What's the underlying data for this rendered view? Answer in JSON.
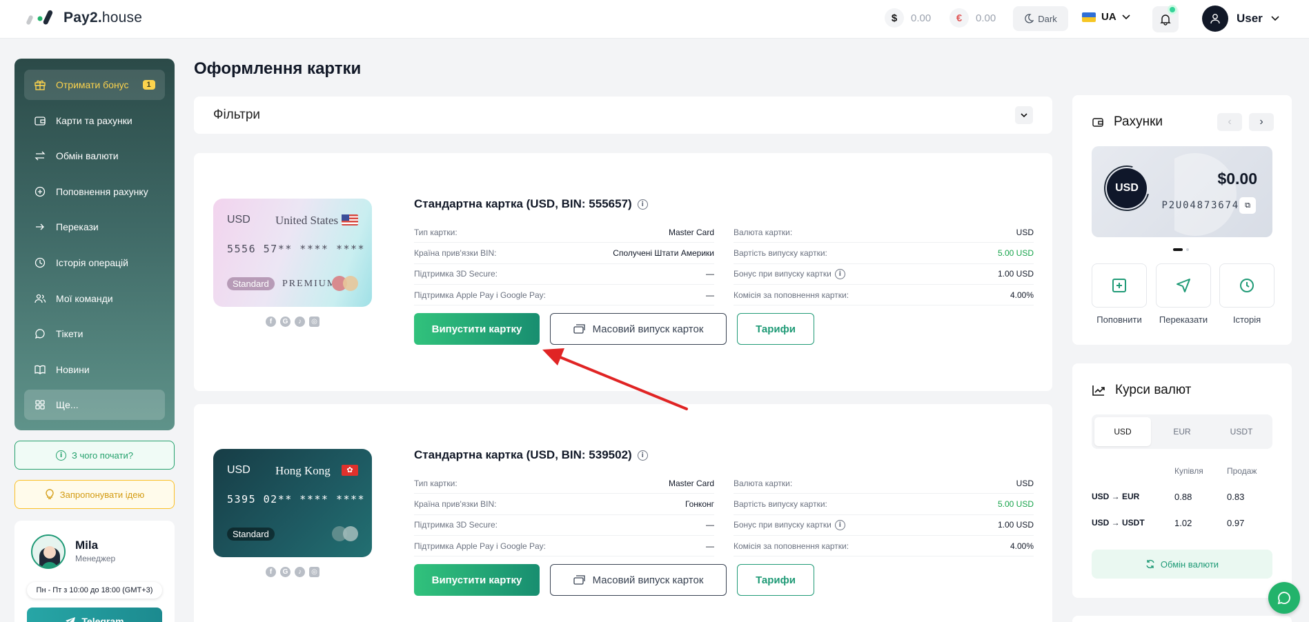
{
  "header": {
    "logo_bold": "Pay2.",
    "logo_rest": "house",
    "usd_balance": "0.00",
    "eur_balance": "0.00",
    "usd_symbol": "$",
    "eur_symbol": "€",
    "dark_label": "Dark",
    "lang": "UA",
    "user_name": "User"
  },
  "sidebar": {
    "items": [
      {
        "label": "Отримати бонус",
        "badge": "1",
        "icon": "gift-icon"
      },
      {
        "label": "Карти та рахунки",
        "icon": "wallet-icon"
      },
      {
        "label": "Обмін валюти",
        "icon": "swap-icon"
      },
      {
        "label": "Поповнення рахунку",
        "icon": "plus-circle-icon"
      },
      {
        "label": "Перекази",
        "icon": "arrow-right-icon"
      },
      {
        "label": "Історія операцій",
        "icon": "clock-icon"
      },
      {
        "label": "Мої команди",
        "icon": "users-icon"
      },
      {
        "label": "Тікети",
        "icon": "chat-icon"
      },
      {
        "label": "Новини",
        "icon": "book-icon"
      },
      {
        "label": "Ще...",
        "icon": "grid-icon"
      }
    ],
    "start_label": "З чого почати?",
    "idea_label": "Запропонувати ідею",
    "manager": {
      "name": "Mila",
      "role": "Менеджер",
      "hours": "Пн - Пт з 10:00 до 18:00 (GMT+3)",
      "telegram": "Telegram"
    }
  },
  "main": {
    "title": "Оформлення картки",
    "filters_label": "Фільтри",
    "cards": [
      {
        "currency": "USD",
        "country": "United States",
        "number": "5556 57** **** ****",
        "tier": "Standard",
        "premium": "PREMIUM",
        "title": "Стандартна картка (USD, BIN: 555657)",
        "left": [
          {
            "label": "Тип картки:",
            "value": "Master Card"
          },
          {
            "label": "Країна прив'язки BIN:",
            "value": "Сполучені Штати Америки"
          },
          {
            "label": "Підтримка 3D Secure:",
            "value": "—"
          },
          {
            "label": "Підтримка Apple Pay і Google Pay:",
            "value": "—"
          }
        ],
        "right": [
          {
            "label": "Валюта картки:",
            "value": "USD"
          },
          {
            "label": "Вартість випуску картки:",
            "value": "5.00 USD"
          },
          {
            "label": "Бонус при випуску картки",
            "value": "1.00 USD"
          },
          {
            "label": "Комісія за поповнення картки:",
            "value": "4.00%"
          }
        ]
      },
      {
        "currency": "USD",
        "country": "Hong Kong",
        "number": "5395 02** **** ****",
        "tier": "Standard",
        "title": "Стандартна картка (USD, BIN: 539502)",
        "left": [
          {
            "label": "Тип картки:",
            "value": "Master Card"
          },
          {
            "label": "Країна прив'язки BIN:",
            "value": "Гонконг"
          },
          {
            "label": "Підтримка 3D Secure:",
            "value": "—"
          },
          {
            "label": "Підтримка Apple Pay і Google Pay:",
            "value": "—"
          }
        ],
        "right": [
          {
            "label": "Валюта картки:",
            "value": "USD"
          },
          {
            "label": "Вартість випуску картки:",
            "value": "5.00 USD"
          },
          {
            "label": "Бонус при випуску картки",
            "value": "1.00 USD"
          },
          {
            "label": "Комісія за поповнення картки:",
            "value": "4.00%"
          }
        ]
      }
    ],
    "issue_label": "Випустити картку",
    "mass_label": "Масовий випуск карток",
    "tariff_label": "Тарифи"
  },
  "accounts": {
    "title": "Рахунки",
    "currency": "USD",
    "amount": "$0.00",
    "account_id": "P2U04873674",
    "actions": [
      "Поповнити",
      "Переказати",
      "Історія"
    ]
  },
  "rates": {
    "title": "Курси валют",
    "tabs": [
      "USD",
      "EUR",
      "USDT"
    ],
    "buy_header": "Купівля",
    "sell_header": "Продаж",
    "rows": [
      {
        "pair": "USD → EUR",
        "buy": "0.88",
        "sell": "0.83"
      },
      {
        "pair": "USD → USDT",
        "buy": "1.02",
        "sell": "0.97"
      }
    ],
    "exchange_label": "Обмін валюти"
  },
  "colors": {
    "accent": "#1f9a76",
    "sidebar_top": "#2b4a48",
    "annotation_arrow": "#e02424"
  }
}
